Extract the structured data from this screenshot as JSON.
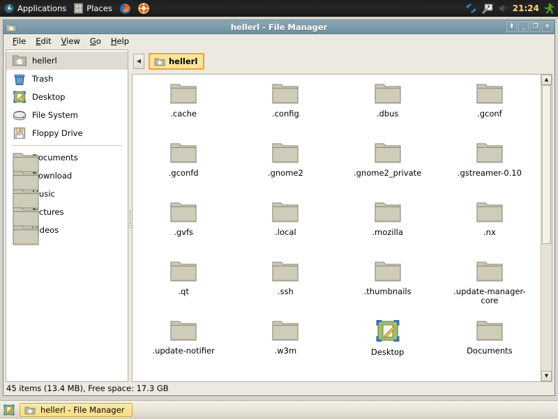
{
  "top_panel": {
    "applications_label": "Applications",
    "places_label": "Places",
    "applications_icon": "gnome-footprint-icon",
    "places_icon": "file-cabinet-icon",
    "launchers": [
      {
        "name": "firefox-icon",
        "title": "Firefox Web Browser"
      },
      {
        "name": "help-lifesaver-icon",
        "title": "Help"
      }
    ],
    "tray": [
      {
        "name": "update-sync-icon"
      },
      {
        "name": "display-settings-icon"
      },
      {
        "name": "volume-icon"
      }
    ],
    "clock": "21:24",
    "session_icon": "running-person-icon"
  },
  "window": {
    "title": "hellerl - File Manager",
    "title_icon": "home-folder-icon",
    "buttons": [
      {
        "name": "shade-button",
        "glyph": "⬆"
      },
      {
        "name": "minimize-button",
        "glyph": "_"
      },
      {
        "name": "maximize-button",
        "glyph": "❐"
      },
      {
        "name": "close-button",
        "glyph": "✕"
      }
    ],
    "menus": [
      {
        "mnemonic": "F",
        "rest": "ile"
      },
      {
        "mnemonic": "E",
        "rest": "dit"
      },
      {
        "mnemonic": "V",
        "rest": "iew"
      },
      {
        "mnemonic": "G",
        "rest": "o"
      },
      {
        "mnemonic": "H",
        "rest": "elp"
      }
    ]
  },
  "sidebar": {
    "places": [
      {
        "label": "hellerl",
        "icon": "home-folder-icon",
        "selected": true
      },
      {
        "label": "Trash",
        "icon": "trash-icon",
        "selected": false
      },
      {
        "label": "Desktop",
        "icon": "desktop-icon",
        "selected": false
      },
      {
        "label": "File System",
        "icon": "harddisk-icon",
        "selected": false
      },
      {
        "label": "Floppy Drive",
        "icon": "floppy-icon",
        "selected": false
      }
    ],
    "folders": [
      {
        "label": "Documents",
        "icon": "folder-icon"
      },
      {
        "label": "Download",
        "icon": "folder-icon"
      },
      {
        "label": "Music",
        "icon": "folder-icon"
      },
      {
        "label": "Pictures",
        "icon": "folder-icon"
      },
      {
        "label": "Videos",
        "icon": "folder-icon"
      }
    ]
  },
  "pathbar": {
    "back_glyph": "◀",
    "crumbs": [
      {
        "label": "hellerl",
        "icon": "home-folder-icon",
        "active": true
      }
    ]
  },
  "files": [
    {
      "name": ".cache",
      "icon": "folder-icon"
    },
    {
      "name": ".config",
      "icon": "folder-icon"
    },
    {
      "name": ".dbus",
      "icon": "folder-icon"
    },
    {
      "name": ".gconf",
      "icon": "folder-icon"
    },
    {
      "name": ".gconfd",
      "icon": "folder-icon"
    },
    {
      "name": ".gnome2",
      "icon": "folder-icon"
    },
    {
      "name": ".gnome2_private",
      "icon": "folder-icon"
    },
    {
      "name": ".gstreamer-0.10",
      "icon": "folder-icon"
    },
    {
      "name": ".gvfs",
      "icon": "folder-icon"
    },
    {
      "name": ".local",
      "icon": "folder-icon"
    },
    {
      "name": ".mozilla",
      "icon": "folder-icon"
    },
    {
      "name": ".nx",
      "icon": "folder-icon"
    },
    {
      "name": ".qt",
      "icon": "folder-icon"
    },
    {
      "name": ".ssh",
      "icon": "folder-icon"
    },
    {
      "name": ".thumbnails",
      "icon": "folder-icon"
    },
    {
      "name": ".update-manager-core",
      "icon": "folder-icon"
    },
    {
      "name": ".update-notifier",
      "icon": "folder-icon"
    },
    {
      "name": ".w3m",
      "icon": "folder-icon"
    },
    {
      "name": "Desktop",
      "icon": "desktop-icon"
    },
    {
      "name": "Documents",
      "icon": "folder-icon"
    }
  ],
  "scrollbar": {
    "up_glyph": "▲",
    "down_glyph": "▼",
    "thumb_percent": 55
  },
  "statusbar": {
    "text": "45 items (13.4 MB), Free space: 17.3 GB"
  },
  "taskbar": {
    "show_desktop_icon": "show-desktop-icon",
    "tasks": [
      {
        "label": "hellerl - File Manager",
        "icon": "home-folder-icon",
        "active": true
      }
    ]
  },
  "colors": {
    "titlebar": "#7d9cab",
    "accent_highlight": "#fbe49a",
    "accent_border": "#e8a33d",
    "panel_bg": "#1d1d1d",
    "window_bg": "#ece9e1",
    "folder_fill": "#c9c7b4",
    "clock_text": "#ffd27f"
  }
}
